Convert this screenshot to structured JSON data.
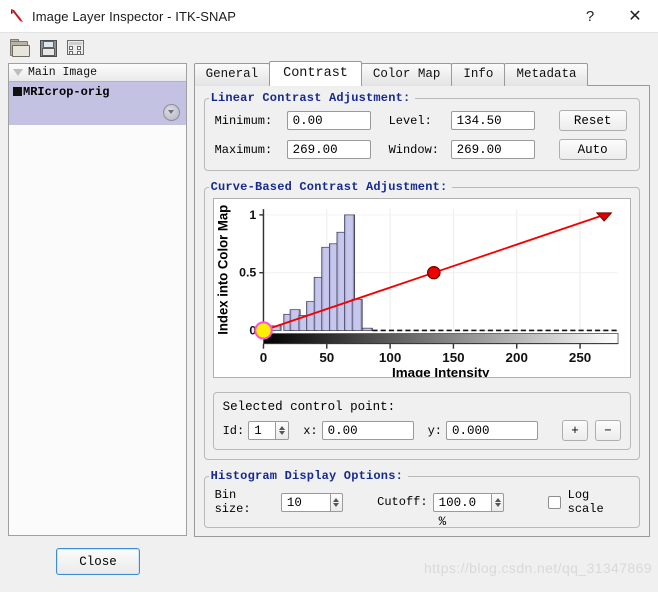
{
  "window": {
    "title": "Image Layer Inspector - ITK-SNAP",
    "help_label": "?",
    "close_label": "✕",
    "app_icon": "itksnap-logo-icon"
  },
  "toolbar": {
    "items": [
      {
        "name": "open-folder-icon",
        "label": "Open"
      },
      {
        "name": "save-icon",
        "label": "Save"
      },
      {
        "name": "table-icon",
        "label": "Layer table"
      }
    ]
  },
  "sidebar": {
    "header": "Main Image",
    "layers": [
      {
        "label": "MRIcrop-orig",
        "selected": true
      }
    ]
  },
  "tabs": [
    {
      "label": "General",
      "active": false
    },
    {
      "label": "Contrast",
      "active": true
    },
    {
      "label": "Color Map",
      "active": false
    },
    {
      "label": "Info",
      "active": false
    },
    {
      "label": "Metadata",
      "active": false
    }
  ],
  "linear_contrast": {
    "title": "Linear Contrast Adjustment:",
    "minimum_label": "Minimum:",
    "minimum_value": "0.00",
    "maximum_label": "Maximum:",
    "maximum_value": "269.00",
    "level_label": "Level:",
    "level_value": "134.50",
    "window_label": "Window:",
    "window_value": "269.00",
    "reset_label": "Reset",
    "auto_label": "Auto"
  },
  "curve_contrast": {
    "title": "Curve-Based Contrast Adjustment:"
  },
  "control_point": {
    "title": "Selected control point:",
    "id_label": "Id:",
    "id_value": "1",
    "x_label": "x:",
    "x_value": "0.00",
    "y_label": "y:",
    "y_value": "0.000",
    "add_label": "+",
    "remove_label": "−"
  },
  "histogram_options": {
    "title": "Histogram Display Options:",
    "bin_size_label": "Bin size:",
    "bin_size_value": "10",
    "cutoff_label": "Cutoff:",
    "cutoff_value": "100.0 %",
    "log_scale_label": "Log scale",
    "log_scale_checked": false
  },
  "footer": {
    "close_label": "Close",
    "watermark": "https://blog.csdn.net/qq_31347869"
  },
  "chart_data": {
    "type": "bar",
    "title": "",
    "xlabel": "Image Intensity",
    "ylabel": "Index into Color Map",
    "xlim": [
      0,
      280
    ],
    "ylim": [
      0,
      1.05
    ],
    "xticks": [
      0,
      50,
      100,
      150,
      200,
      250
    ],
    "yticks": [
      0,
      0.5,
      1
    ],
    "grid": true,
    "bin_size": 10,
    "bars": [
      {
        "x": 0,
        "value": 0.02
      },
      {
        "x": 10,
        "value": 0.04
      },
      {
        "x": 20,
        "value": 0.14
      },
      {
        "x": 25,
        "value": 0.18
      },
      {
        "x": 32,
        "value": 0.13
      },
      {
        "x": 38,
        "value": 0.25
      },
      {
        "x": 44,
        "value": 0.46
      },
      {
        "x": 50,
        "value": 0.72
      },
      {
        "x": 56,
        "value": 0.75
      },
      {
        "x": 62,
        "value": 0.85
      },
      {
        "x": 68,
        "value": 1.0
      },
      {
        "x": 74,
        "value": 0.27
      },
      {
        "x": 82,
        "value": 0.02
      }
    ],
    "curve": {
      "name": "intensity-curve",
      "color": "#f40000",
      "points": [
        {
          "id": 1,
          "x": 0,
          "y": 0.0,
          "selected": true
        },
        {
          "id": 2,
          "x": 134.5,
          "y": 0.5,
          "selected": false
        },
        {
          "id": 3,
          "x": 269,
          "y": 1.0,
          "selected": false
        }
      ]
    },
    "colorbar": {
      "from": "#000000",
      "to": "#ffffff"
    }
  }
}
